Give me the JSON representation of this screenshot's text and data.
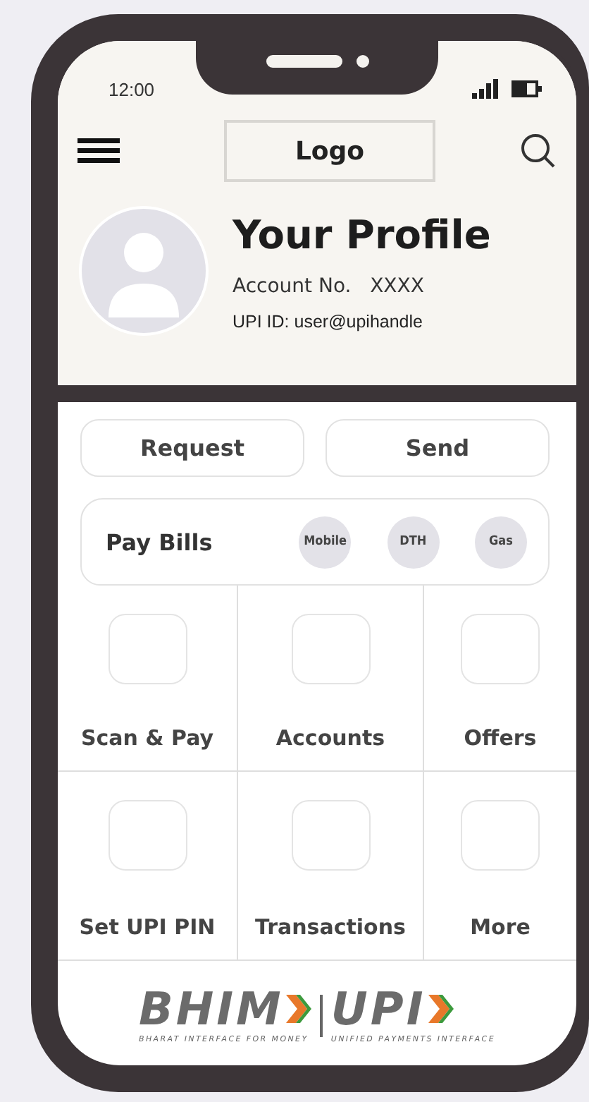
{
  "status_bar": {
    "time": "12:00"
  },
  "header": {
    "logo": "Logo"
  },
  "profile": {
    "title": "Your Profile",
    "account_label": "Account No.",
    "account_value": "XXXX",
    "upi_id": "UPI ID: user@upihandle"
  },
  "actions": [
    "Request",
    "Send"
  ],
  "pay_bills": {
    "label": "Pay Bills",
    "options": [
      "Mobile",
      "DTH",
      "Gas"
    ]
  },
  "tiles": [
    "Scan & Pay",
    "Accounts",
    "Offers",
    "Set UPI PIN",
    "Transactions",
    "More"
  ],
  "footer": {
    "brand": "BHIM",
    "tagline": "BHARAT INTERFACE FOR MONEY",
    "brand_2": "UPI",
    "tagline_2": "UNIFIED PAYMENTS INTERFACE"
  }
}
